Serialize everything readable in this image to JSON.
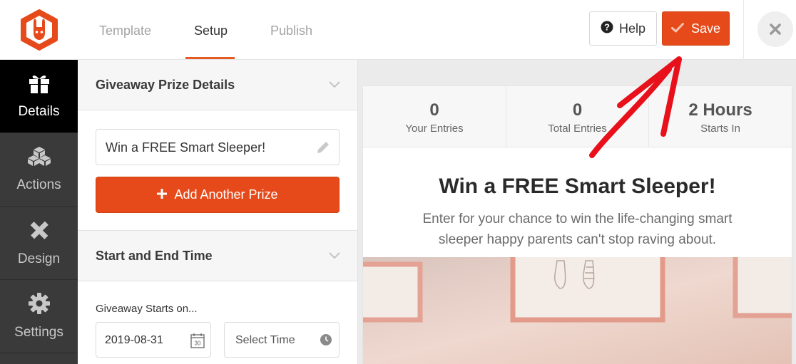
{
  "colors": {
    "brand_orange": "#e64a1a",
    "sidebar_dark": "#3a3a3a",
    "sidebar_active": "#000000",
    "annotation_red": "#e8101a"
  },
  "header": {
    "logo_icon": "rabbit-logo",
    "tabs": [
      {
        "label": "Template",
        "active": false
      },
      {
        "label": "Setup",
        "active": true
      },
      {
        "label": "Publish",
        "active": false
      }
    ],
    "help_label": "Help",
    "help_icon": "question-circle-icon",
    "save_label": "Save",
    "save_icon": "check-icon",
    "close_icon": "close-icon"
  },
  "sidebar": {
    "items": [
      {
        "label": "Details",
        "icon": "gift-icon",
        "active": true
      },
      {
        "label": "Actions",
        "icon": "cubes-icon",
        "active": false
      },
      {
        "label": "Design",
        "icon": "pencil-ruler-icon",
        "active": false
      },
      {
        "label": "Settings",
        "icon": "gear-icon",
        "active": false
      }
    ]
  },
  "panel": {
    "prize_section": {
      "title": "Giveaway Prize Details",
      "prize_value": "Win a FREE Smart Sleeper!",
      "add_prize_label": "Add Another Prize"
    },
    "time_section": {
      "title": "Start and End Time",
      "starts_label": "Giveaway Starts on...",
      "start_date": "2019-08-31",
      "calendar_day": "30",
      "time_placeholder": "Select Time"
    }
  },
  "preview": {
    "stats": [
      {
        "value": "0",
        "label": "Your Entries"
      },
      {
        "value": "0",
        "label": "Total Entries"
      },
      {
        "value": "2 Hours",
        "label": "Starts In"
      }
    ],
    "title": "Win a FREE Smart Sleeper!",
    "description": "Enter for your chance to win the life-changing smart sleeper happy parents can't stop raving about."
  }
}
